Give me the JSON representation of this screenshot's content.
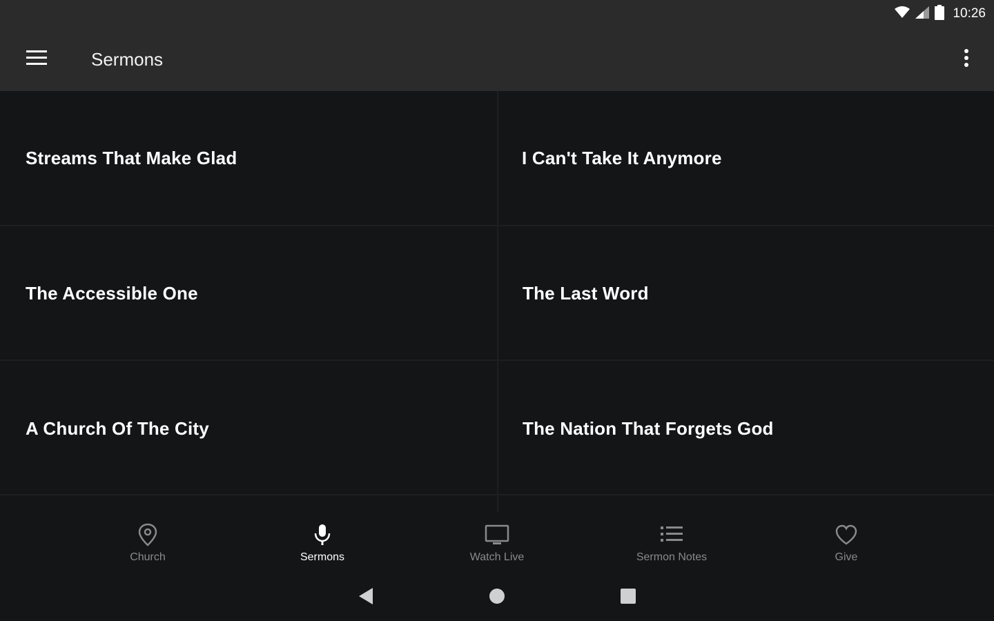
{
  "status_bar": {
    "time": "10:26"
  },
  "app_bar": {
    "title": "Sermons"
  },
  "sermons": [
    {
      "title": "Streams That Make Glad"
    },
    {
      "title": "I Can't Take It Anymore"
    },
    {
      "title": "The Accessible One"
    },
    {
      "title": "The Last Word"
    },
    {
      "title": "A Church Of The City"
    },
    {
      "title": "The Nation That Forgets God"
    }
  ],
  "bottom_nav": [
    {
      "label": "Church",
      "icon": "location-pin-icon"
    },
    {
      "label": "Sermons",
      "icon": "microphone-icon",
      "active": true
    },
    {
      "label": "Watch Live",
      "icon": "monitor-icon"
    },
    {
      "label": "Sermon Notes",
      "icon": "list-icon"
    },
    {
      "label": "Give",
      "icon": "heart-icon"
    }
  ],
  "colors": {
    "app_bar_bg": "#2b2b2c",
    "content_bg": "#141517",
    "inactive_nav": "#8a8a8a",
    "active_nav": "#ffffff"
  }
}
